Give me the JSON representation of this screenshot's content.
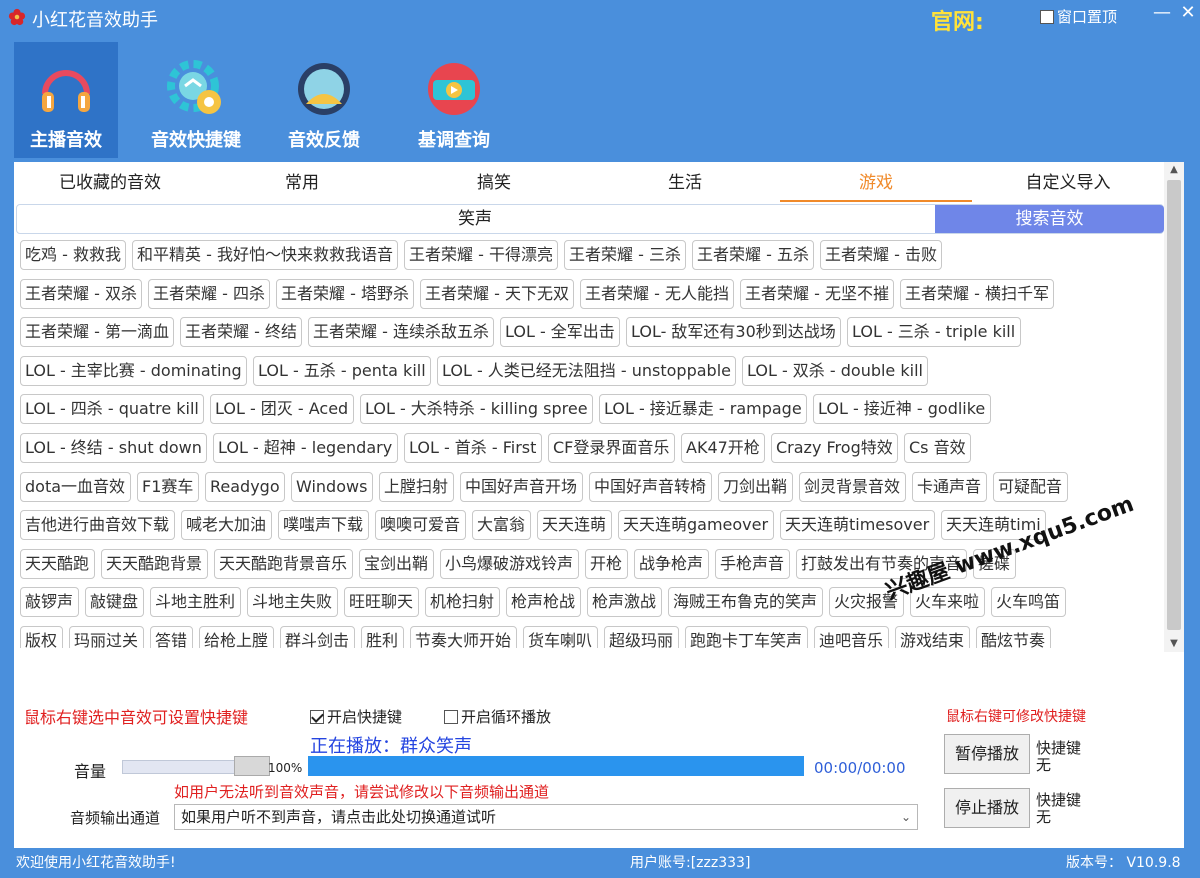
{
  "window": {
    "title": "小红花音效助手",
    "official_label": "官网:",
    "pin_label": "窗口置顶",
    "pin_checked": false
  },
  "toolbar": [
    {
      "label": "主播音效",
      "icon": "headphones-icon",
      "active": true
    },
    {
      "label": "音效快捷键",
      "icon": "gear-icon",
      "active": false
    },
    {
      "label": "音效反馈",
      "icon": "avatar-icon",
      "active": false
    },
    {
      "label": "基调查询",
      "icon": "media-player-icon",
      "active": false
    }
  ],
  "categories": [
    "已收藏的音效",
    "常用",
    "搞笑",
    "生活",
    "游戏",
    "自定义导入"
  ],
  "active_category": "游戏",
  "sub_tab": "笑声",
  "search_tab": "搜索音效",
  "sound_rows": [
    [
      "吃鸡 - 救救我",
      "和平精英 - 我好怕～快来救救我语音",
      "王者荣耀 - 干得漂亮",
      "王者荣耀 - 三杀",
      "王者荣耀 - 五杀",
      "王者荣耀 - 击败"
    ],
    [
      "王者荣耀 - 双杀",
      "王者荣耀 - 四杀",
      "王者荣耀 - 塔野杀",
      "王者荣耀 - 天下无双",
      "王者荣耀 - 无人能挡",
      "王者荣耀 - 无坚不摧",
      "王者荣耀 - 横扫千军"
    ],
    [
      "王者荣耀 - 第一滴血",
      "王者荣耀 - 终结",
      "王者荣耀 - 连续杀敌五杀",
      "LOL - 全军出击",
      "LOL- 敌军还有30秒到达战场",
      "LOL - 三杀 - triple kill"
    ],
    [
      "LOL - 主宰比赛 - dominating",
      "LOL - 五杀 - penta kill",
      "LOL - 人类已经无法阻挡 - unstoppable",
      "LOL - 双杀 - double kill"
    ],
    [
      "LOL - 四杀 - quatre kill",
      "LOL - 团灭 - Aced",
      "LOL - 大杀特杀 - killing spree",
      "LOL - 接近暴走 - rampage",
      "LOL - 接近神 - godlike"
    ],
    [
      "LOL - 终结 - shut down",
      "LOL - 超神 - legendary",
      "LOL - 首杀 - First",
      "CF登录界面音乐",
      "AK47开枪",
      "Crazy Frog特效",
      "Cs 音效"
    ],
    [
      "dota一血音效",
      "F1赛车",
      "Readygo",
      "Windows",
      "上膛扫射",
      "中国好声音开场",
      "中国好声音转椅",
      "刀剑出鞘",
      "剑灵背景音效",
      "卡通声音",
      "可疑配音"
    ],
    [
      "吉他进行曲音效下载",
      "喊老大加油",
      "噗嗤声下载",
      "噢噢可爱音",
      "大富翁",
      "天天连萌",
      "天天连萌gameover",
      "天天连萌timesover",
      "天天连萌timi"
    ],
    [
      "天天酷跑",
      "天天酷跑背景",
      "天天酷跑背景音乐",
      "宝剑出鞘",
      "小鸟爆破游戏铃声",
      "开枪",
      "战争枪声",
      "手枪声音",
      "打鼓发出有节奏的声音",
      "搓碟"
    ],
    [
      "敲锣声",
      "敲键盘",
      "斗地主胜利",
      "斗地主失败",
      "旺旺聊天",
      "机枪扫射",
      "枪声枪战",
      "枪声激战",
      "海贼王布鲁克的笑声",
      "火灾报警",
      "火车来啦",
      "火车鸣笛"
    ],
    [
      "版权",
      "玛丽过关",
      "答错",
      "给枪上膛",
      "群斗剑击",
      "胜利",
      "节奏大师开始",
      "货车喇叭",
      "超级玛丽",
      "跑跑卡丁车笑声",
      "迪吧音乐",
      "游戏结束",
      "酷炫节奏"
    ]
  ],
  "tips": {
    "right_click_left": "鼠标右键选中音效可设置快捷键",
    "right_click_right": "鼠标右键可修改快捷键",
    "output_hint": "如用户无法听到音效声音，请尝试修改以下音频输出通道"
  },
  "options": {
    "hotkey_label": "开启快捷键",
    "hotkey_checked": true,
    "loop_label": "开启循环播放",
    "loop_checked": false
  },
  "player": {
    "now_playing": "正在播放：群众笑声",
    "volume_label": "音量",
    "volume_percent": "100%",
    "volume": 1.0,
    "progress": 1.0,
    "time": "00:00/00:00"
  },
  "output": {
    "label": "音频输出通道",
    "selected": "如果用户听不到声音，请点击此处切换通道试听"
  },
  "buttons": {
    "pause": "暂停播放",
    "stop": "停止播放",
    "hotkey_title": "快捷键",
    "hotkey_value": "无"
  },
  "watermark": "兴趣屋 www.xqu5.com",
  "status": {
    "welcome": "欢迎使用小红花音效助手!",
    "account": "用户账号:[zzz333]",
    "version": "版本号： V10.9.8"
  },
  "colors": {
    "accent": "#4a8fdc",
    "tab_active": "#f08a2a",
    "search": "#6f86e8",
    "progress": "#2a94ee",
    "tip": "#e02020"
  }
}
